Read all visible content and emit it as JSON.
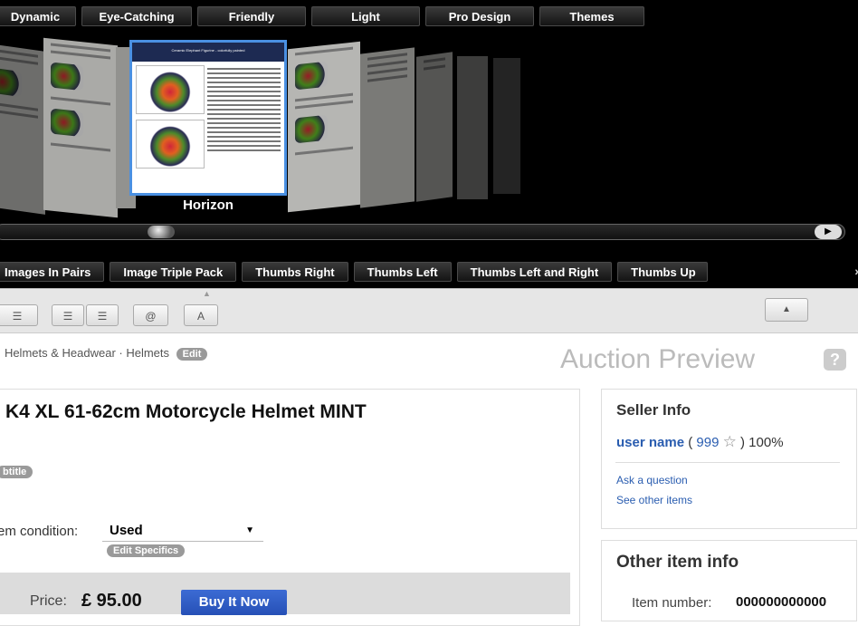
{
  "theme_tabs_top": [
    "Dynamic",
    "Eye-Catching",
    "Friendly",
    "Light",
    "Pro Design",
    "Themes"
  ],
  "carousel": {
    "selected_label": "Horizon",
    "preview_header": "Ceramic Elephant Figurine - colorfully painted"
  },
  "theme_tabs_bottom": [
    "Images In Pairs",
    "Image Triple Pack",
    "Thumbs Right",
    "Thumbs Left",
    "Thumbs Left and Right",
    "Thumbs Up"
  ],
  "more_arrow": "»",
  "toolbar": {
    "buttons": [
      "bullet-list-icon",
      "indent-icon",
      "outdent-icon",
      "at-icon",
      "font-size-icon"
    ],
    "email_glyph": "@",
    "font_glyph": "A"
  },
  "breadcrumb": {
    "text": "· Helmets & Headwear · Helmets",
    "edit_label": "Edit"
  },
  "preview_title": "Auction Preview",
  "help_glyph": "?",
  "item": {
    "title": "K4 XL 61-62cm Motorcycle Helmet MINT",
    "subtitle_label": "btitle",
    "condition_label": "em condition:",
    "condition_value": "Used",
    "edit_specifics_label": "Edit Specifics",
    "price_label": "Price:",
    "price_value": "£ 95.00",
    "buy_label": "Buy It Now"
  },
  "seller": {
    "heading": "Seller Info",
    "user_name": "user name",
    "feedback_score": "999",
    "positive_pct": ") 100%",
    "ask_question": "Ask a question",
    "see_other": "See other items"
  },
  "other_info": {
    "heading": "Other item info",
    "item_number_label": "Item number:",
    "item_number_value": "000000000000"
  },
  "colors": {
    "selection_border": "#4a90e2",
    "link": "#2a5db0",
    "buy_button": "#2c57c2"
  }
}
